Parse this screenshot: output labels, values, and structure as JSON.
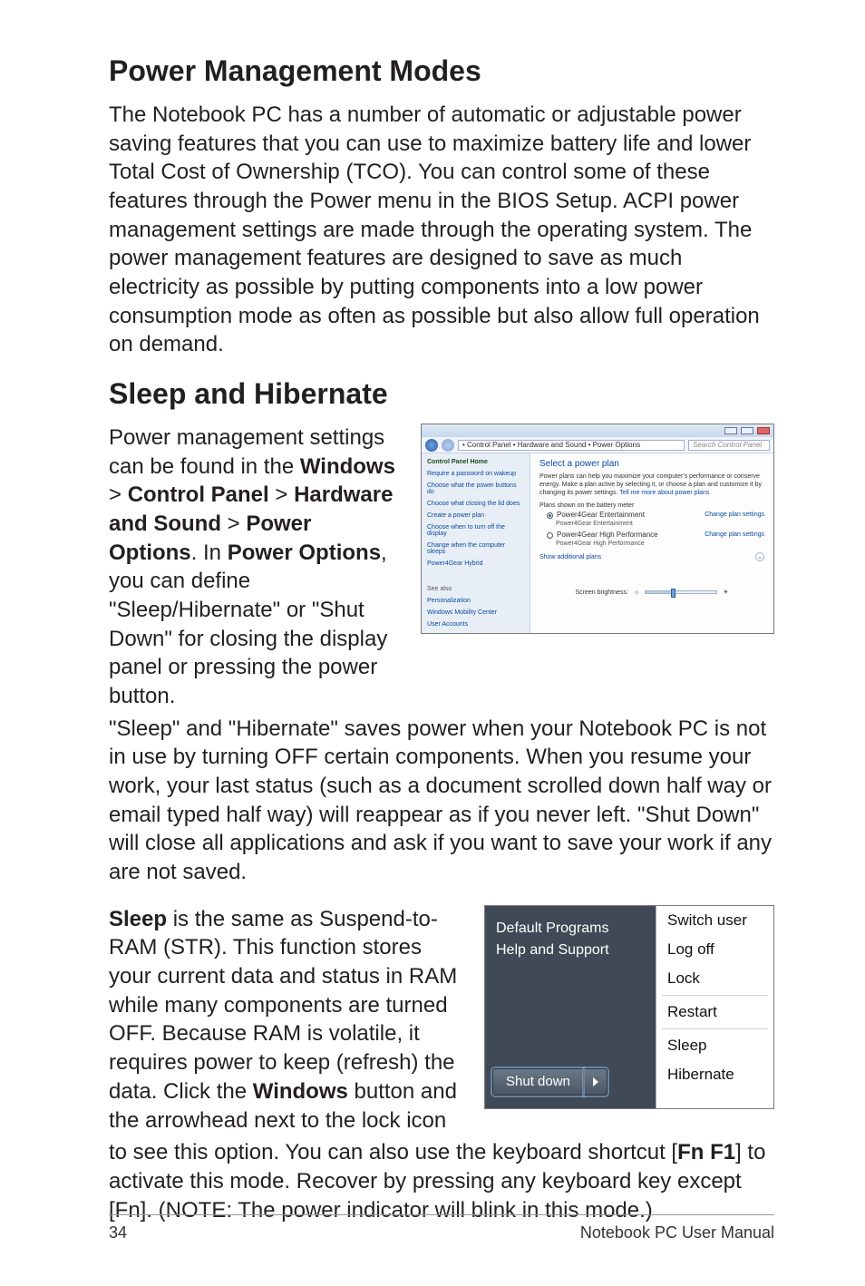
{
  "h1": "Power Management Modes",
  "p1": "The Notebook PC has a number of automatic or adjustable power saving features that you can use to maximize battery life and lower Total Cost of Ownership (TCO). You can control some of these features through the Power menu in the BIOS Setup. ACPI power management settings are made through the operating system. The power management features are designed to save as much electricity as possible by putting components into a low power consumption mode as often as possible but also allow full operation on demand.",
  "h2": "Sleep and Hibernate",
  "p2a": "Power management settings can be found in the ",
  "p2b": "Windows",
  "p2c": " > ",
  "p2d": "Control Panel",
  "p2e": " > ",
  "p2f": "Hardware and Sound",
  "p2g": " > ",
  "p2h": "Power Options",
  "p2i": ". In ",
  "p2j": "Power Options",
  "p2k": ", you can define \"Sleep/Hibernate\" or \"Shut Down\" for closing the display panel or pressing the power button.",
  "p3": "\"Sleep\" and \"Hibernate\" saves power when your Notebook PC is not in use by turning OFF certain components. When you resume your work, your last status (such as a document scrolled down half way or email typed half way) will reappear as if you never left. \"Shut Down\" will close all applications and ask if you want to save your work if any are not saved.",
  "p4a": "Sleep",
  "p4b": " is the same as Suspend-to-RAM (STR). This function stores your current data and status in RAM while many components are turned OFF. Because RAM is volatile, it requires power to keep (refresh) the data. Click the ",
  "p4c": "Windows",
  "p4d": " button and the arrowhead next to the lock icon",
  "p5a": "to see this option. You can also use the keyboard shortcut [",
  "p5b": "Fn F1",
  "p5c": "] to activate this mode. Recover by pressing any keyboard key except [Fn]. (NOTE: The power indicator will blink in this mode.)",
  "fig1": {
    "breadcrumb": "• Control Panel • Hardware and Sound • Power Options",
    "search_placeholder": "Search Control Panel",
    "side_header": "Control Panel Home",
    "side_items": [
      "Require a password on wakeup",
      "Choose what the power buttons do",
      "Choose what closing the lid does",
      "Create a power plan",
      "Choose when to turn off the display",
      "Change when the computer sleeps",
      "Power4Gear Hybrid"
    ],
    "side_footer": [
      "See also",
      "Personalization",
      "Windows Mobility Center",
      "User Accounts"
    ],
    "main_title": "Select a power plan",
    "main_desc": "Power plans can help you maximize your computer's performance or conserve energy. Make a plan active by selecting it, or choose a plan and customize it by changing its power settings. ",
    "main_desc_link": "Tell me more about power plans",
    "meter_label": "Plans shown on the battery meter",
    "plan1_name": "Power4Gear Entertainment",
    "plan1_sub": "Power4Gear Entertainment",
    "plan2_name": "Power4Gear High Performance",
    "plan2_sub": "Power4Gear High Performance",
    "change_link": "Change plan settings",
    "show_more": "Show additional plans",
    "brightness_label": "Screen brightness:"
  },
  "fig2": {
    "left_items": [
      "Default Programs",
      "Help and Support"
    ],
    "shutdown": "Shut down",
    "menu": [
      "Switch user",
      "Log off",
      "Lock",
      "Restart",
      "Sleep",
      "Hibernate"
    ]
  },
  "footer_page": "34",
  "footer_title": "Notebook PC User Manual"
}
